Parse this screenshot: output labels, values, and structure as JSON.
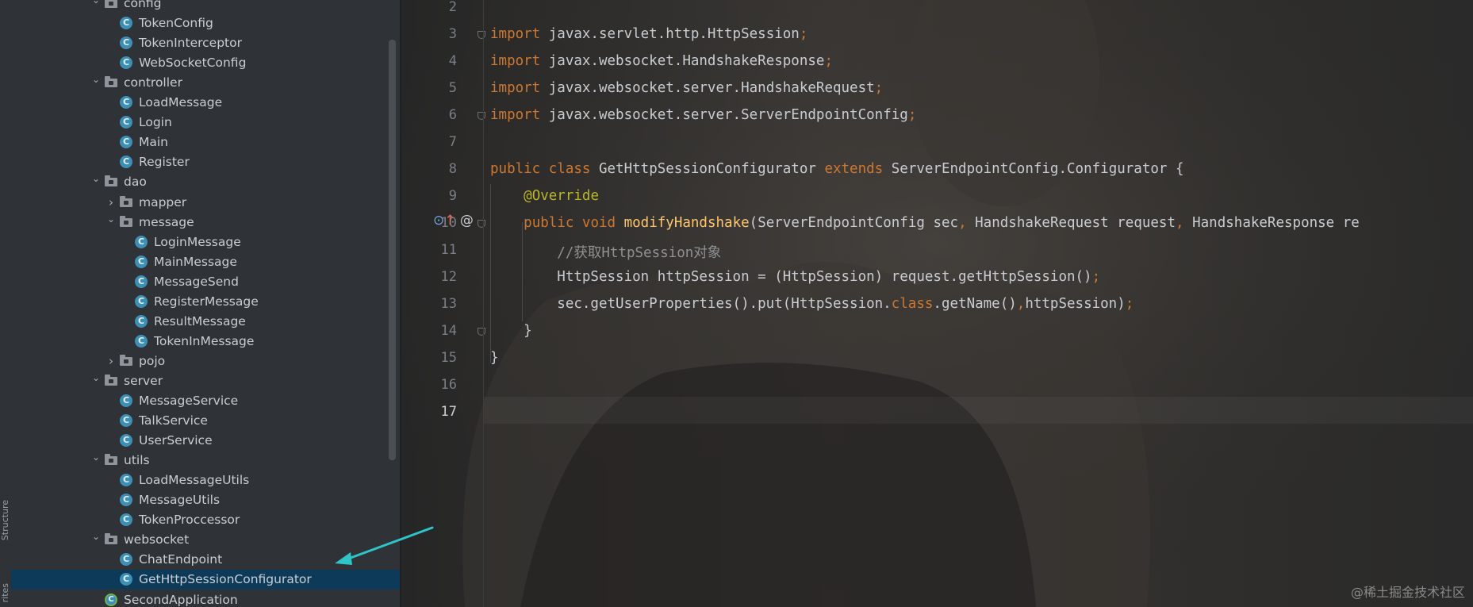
{
  "side_labels": {
    "structure": "Structure",
    "favorites": "rites"
  },
  "tree": [
    {
      "label": "config",
      "kind": "folder",
      "depth": 1,
      "expanded": true
    },
    {
      "label": "TokenConfig",
      "kind": "class",
      "depth": 2
    },
    {
      "label": "TokenInterceptor",
      "kind": "class",
      "depth": 2
    },
    {
      "label": "WebSocketConfig",
      "kind": "class",
      "depth": 2
    },
    {
      "label": "controller",
      "kind": "folder",
      "depth": 1,
      "expanded": true
    },
    {
      "label": "LoadMessage",
      "kind": "class",
      "depth": 2
    },
    {
      "label": "Login",
      "kind": "class",
      "depth": 2
    },
    {
      "label": "Main",
      "kind": "class",
      "depth": 2
    },
    {
      "label": "Register",
      "kind": "class",
      "depth": 2
    },
    {
      "label": "dao",
      "kind": "folder",
      "depth": 1,
      "expanded": true
    },
    {
      "label": "mapper",
      "kind": "folder",
      "depth": 2,
      "expanded": false
    },
    {
      "label": "message",
      "kind": "folder",
      "depth": 2,
      "expanded": true
    },
    {
      "label": "LoginMessage",
      "kind": "class",
      "depth": 3
    },
    {
      "label": "MainMessage",
      "kind": "class",
      "depth": 3
    },
    {
      "label": "MessageSend",
      "kind": "class",
      "depth": 3
    },
    {
      "label": "RegisterMessage",
      "kind": "class",
      "depth": 3
    },
    {
      "label": "ResultMessage",
      "kind": "class",
      "depth": 3
    },
    {
      "label": "TokenInMessage",
      "kind": "class",
      "depth": 3
    },
    {
      "label": "pojo",
      "kind": "folder",
      "depth": 2,
      "expanded": false
    },
    {
      "label": "server",
      "kind": "folder",
      "depth": 1,
      "expanded": true
    },
    {
      "label": "MessageService",
      "kind": "class",
      "depth": 2
    },
    {
      "label": "TalkService",
      "kind": "class",
      "depth": 2
    },
    {
      "label": "UserService",
      "kind": "class",
      "depth": 2
    },
    {
      "label": "utils",
      "kind": "folder",
      "depth": 1,
      "expanded": true
    },
    {
      "label": "LoadMessageUtils",
      "kind": "class",
      "depth": 2
    },
    {
      "label": "MessageUtils",
      "kind": "class",
      "depth": 2
    },
    {
      "label": "TokenProccessor",
      "kind": "class",
      "depth": 2
    },
    {
      "label": "websocket",
      "kind": "folder",
      "depth": 1,
      "expanded": true
    },
    {
      "label": "ChatEndpoint",
      "kind": "class",
      "depth": 2
    },
    {
      "label": "GetHttpSessionConfigurator",
      "kind": "class",
      "depth": 2,
      "selected": true
    },
    {
      "label": "SecondApplication",
      "kind": "app",
      "depth": 1
    }
  ],
  "class_icon_letter": "C",
  "line_numbers": [
    "2",
    "3",
    "4",
    "5",
    "6",
    "7",
    "8",
    "9",
    "10",
    "11",
    "12",
    "13",
    "14",
    "15",
    "16",
    "17"
  ],
  "current_line": "17",
  "gutter_icons": {
    "override": "⊙",
    "arrow": "↑",
    "at": "@"
  },
  "code_lines": [
    [],
    [
      {
        "t": "import",
        "c": "kw"
      },
      {
        "t": " javax.servlet.http.HttpSession"
      },
      {
        "t": ";",
        "c": "kw"
      }
    ],
    [
      {
        "t": "import",
        "c": "kw"
      },
      {
        "t": " javax.websocket.HandshakeResponse"
      },
      {
        "t": ";",
        "c": "kw"
      }
    ],
    [
      {
        "t": "import",
        "c": "kw"
      },
      {
        "t": " javax.websocket.server.HandshakeRequest"
      },
      {
        "t": ";",
        "c": "kw"
      }
    ],
    [
      {
        "t": "import",
        "c": "kw"
      },
      {
        "t": " javax.websocket.server.ServerEndpointConfig"
      },
      {
        "t": ";",
        "c": "kw"
      }
    ],
    [],
    [
      {
        "t": "public class",
        "c": "kw"
      },
      {
        "t": " GetHttpSessionConfigurator "
      },
      {
        "t": "extends",
        "c": "kw"
      },
      {
        "t": " ServerEndpointConfig.Configurator {"
      }
    ],
    [
      {
        "t": "    "
      },
      {
        "t": "@Override",
        "c": "ann"
      }
    ],
    [
      {
        "t": "    "
      },
      {
        "t": "public void",
        "c": "kw"
      },
      {
        "t": " "
      },
      {
        "t": "modifyHandshake",
        "c": "fn"
      },
      {
        "t": "(ServerEndpointConfig sec"
      },
      {
        "t": ",",
        "c": "kw"
      },
      {
        "t": " HandshakeRequest request"
      },
      {
        "t": ",",
        "c": "kw"
      },
      {
        "t": " HandshakeResponse re"
      }
    ],
    [
      {
        "t": "        "
      },
      {
        "t": "//获取HttpSession对象",
        "c": "cm"
      }
    ],
    [
      {
        "t": "        HttpSession httpSession = (HttpSession) request.getHttpSession()"
      },
      {
        "t": ";",
        "c": "kw"
      }
    ],
    [
      {
        "t": "        sec.getUserProperties().put(HttpSession."
      },
      {
        "t": "class",
        "c": "kw"
      },
      {
        "t": ".getName()"
      },
      {
        "t": ",",
        "c": "kw"
      },
      {
        "t": "httpSession)"
      },
      {
        "t": ";",
        "c": "kw"
      }
    ],
    [
      {
        "t": "    }"
      }
    ],
    [
      {
        "t": "}"
      }
    ],
    [],
    []
  ],
  "watermark": "@稀土掘金技术社区",
  "colors": {
    "keyword": "#cc7832",
    "annotation": "#bbb529",
    "method": "#ffc66d",
    "comment": "#8e9092",
    "selection": "#0d3a58",
    "arrow": "#2ec4c9"
  }
}
